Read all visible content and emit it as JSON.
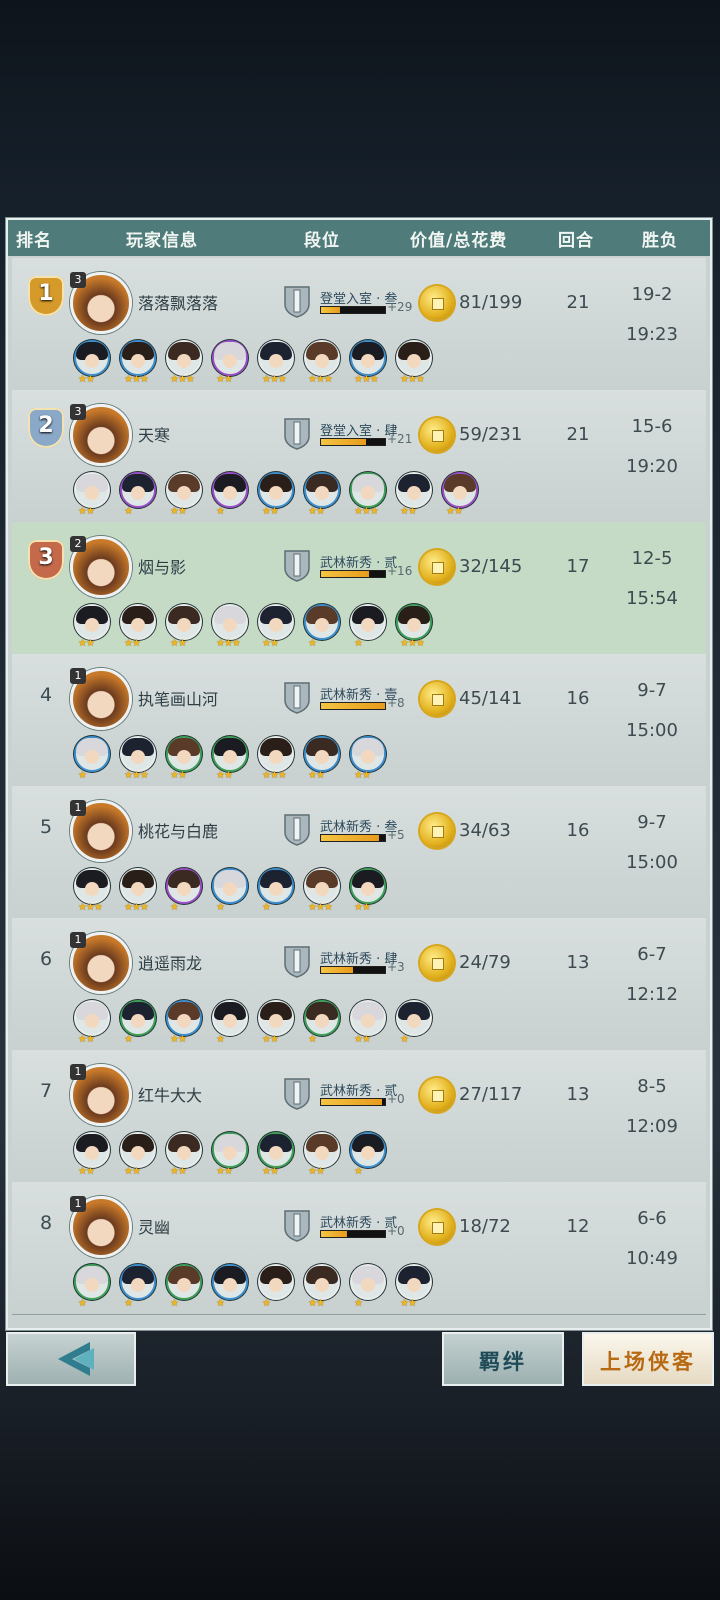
{
  "header": {
    "rank": "排名",
    "player": "玩家信息",
    "segment": "段位",
    "value": "价值/总花费",
    "round": "回合",
    "winloss": "胜负"
  },
  "rows": [
    {
      "rank": "1",
      "medal": "gold",
      "level": "3",
      "name": "落落飘落落",
      "segment": "登堂入室 · 叁",
      "progress": 0.3,
      "points": "+29",
      "value": "81/199",
      "round": "21",
      "wl": "19-2",
      "time": "19:23",
      "highlight": false,
      "heroes": [
        {
          "ring": "blue",
          "stars": "★★"
        },
        {
          "ring": "blue",
          "stars": "★★★"
        },
        {
          "ring": "dark",
          "stars": "★★★"
        },
        {
          "ring": "purple",
          "stars": "★★"
        },
        {
          "ring": "dark",
          "stars": "★★★"
        },
        {
          "ring": "dark",
          "stars": "★★★"
        },
        {
          "ring": "blue",
          "stars": "★★★"
        },
        {
          "ring": "dark",
          "stars": "★★★"
        }
      ]
    },
    {
      "rank": "2",
      "medal": "silver",
      "level": "3",
      "name": "天寒",
      "segment": "登堂入室 · 肆",
      "progress": 0.7,
      "points": "+21",
      "value": "59/231",
      "round": "21",
      "wl": "15-6",
      "time": "19:20",
      "highlight": false,
      "heroes": [
        {
          "ring": "dark",
          "stars": "★★"
        },
        {
          "ring": "purple",
          "stars": "★"
        },
        {
          "ring": "dark",
          "stars": "★★"
        },
        {
          "ring": "purple",
          "stars": "★"
        },
        {
          "ring": "blue",
          "stars": "★★"
        },
        {
          "ring": "blue",
          "stars": "★★"
        },
        {
          "ring": "green",
          "stars": "★★★"
        },
        {
          "ring": "dark",
          "stars": "★★"
        },
        {
          "ring": "purple",
          "stars": "★★"
        }
      ]
    },
    {
      "rank": "3",
      "medal": "bronze",
      "level": "2",
      "name": "烟与影",
      "segment": "武林新秀 · 贰",
      "progress": 0.75,
      "points": "+16",
      "value": "32/145",
      "round": "17",
      "wl": "12-5",
      "time": "15:54",
      "highlight": true,
      "heroes": [
        {
          "ring": "dark",
          "stars": "★★"
        },
        {
          "ring": "dark",
          "stars": "★★"
        },
        {
          "ring": "dark",
          "stars": "★★"
        },
        {
          "ring": "dark",
          "stars": "★★★"
        },
        {
          "ring": "dark",
          "stars": "★★"
        },
        {
          "ring": "blue",
          "stars": "★"
        },
        {
          "ring": "dark",
          "stars": "★"
        },
        {
          "ring": "green",
          "stars": "★★★"
        }
      ]
    },
    {
      "rank": "4",
      "medal": "",
      "level": "1",
      "name": "执笔画山河",
      "segment": "武林新秀 · 壹",
      "progress": 1.0,
      "points": "+8",
      "value": "45/141",
      "round": "16",
      "wl": "9-7",
      "time": "15:00",
      "highlight": false,
      "heroes": [
        {
          "ring": "blue",
          "stars": "★"
        },
        {
          "ring": "dark",
          "stars": "★★★"
        },
        {
          "ring": "green",
          "stars": "★★"
        },
        {
          "ring": "green",
          "stars": "★★"
        },
        {
          "ring": "dark",
          "stars": "★★★"
        },
        {
          "ring": "blue",
          "stars": "★★"
        },
        {
          "ring": "blue",
          "stars": "★★"
        }
      ]
    },
    {
      "rank": "5",
      "medal": "",
      "level": "1",
      "name": "桃花与白鹿",
      "segment": "武林新秀 · 叁",
      "progress": 0.9,
      "points": "+5",
      "value": "34/63",
      "round": "16",
      "wl": "9-7",
      "time": "15:00",
      "highlight": false,
      "heroes": [
        {
          "ring": "dark",
          "stars": "★★★"
        },
        {
          "ring": "dark",
          "stars": "★★★"
        },
        {
          "ring": "purple",
          "stars": "★"
        },
        {
          "ring": "blue",
          "stars": "★"
        },
        {
          "ring": "blue",
          "stars": "★"
        },
        {
          "ring": "dark",
          "stars": "★★★"
        },
        {
          "ring": "green",
          "stars": "★★"
        }
      ]
    },
    {
      "rank": "6",
      "medal": "",
      "level": "1",
      "name": "逍遥雨龙",
      "segment": "武林新秀 · 肆",
      "progress": 0.5,
      "points": "+3",
      "value": "24/79",
      "round": "13",
      "wl": "6-7",
      "time": "12:12",
      "highlight": false,
      "heroes": [
        {
          "ring": "dark",
          "stars": "★★"
        },
        {
          "ring": "green",
          "stars": "★"
        },
        {
          "ring": "blue",
          "stars": "★★"
        },
        {
          "ring": "dark",
          "stars": "★"
        },
        {
          "ring": "dark",
          "stars": "★★"
        },
        {
          "ring": "green",
          "stars": "★"
        },
        {
          "ring": "dark",
          "stars": "★★"
        },
        {
          "ring": "dark",
          "stars": "★"
        }
      ]
    },
    {
      "rank": "7",
      "medal": "",
      "level": "1",
      "name": "红牛大大",
      "segment": "武林新秀 · 贰",
      "progress": 0.95,
      "points": "+0",
      "value": "27/117",
      "round": "13",
      "wl": "8-5",
      "time": "12:09",
      "highlight": false,
      "heroes": [
        {
          "ring": "dark",
          "stars": "★★"
        },
        {
          "ring": "dark",
          "stars": "★★"
        },
        {
          "ring": "dark",
          "stars": "★★"
        },
        {
          "ring": "green",
          "stars": "★★"
        },
        {
          "ring": "green",
          "stars": "★★"
        },
        {
          "ring": "dark",
          "stars": "★★"
        },
        {
          "ring": "blue",
          "stars": "★"
        }
      ]
    },
    {
      "rank": "8",
      "medal": "",
      "level": "1",
      "name": "灵幽",
      "segment": "武林新秀 · 贰",
      "progress": 0.4,
      "points": "+0",
      "value": "18/72",
      "round": "12",
      "wl": "6-6",
      "time": "10:49",
      "highlight": false,
      "heroes": [
        {
          "ring": "green",
          "stars": "★"
        },
        {
          "ring": "blue",
          "stars": "★"
        },
        {
          "ring": "green",
          "stars": "★"
        },
        {
          "ring": "blue",
          "stars": "★"
        },
        {
          "ring": "dark",
          "stars": "★"
        },
        {
          "ring": "dark",
          "stars": "★★"
        },
        {
          "ring": "dark",
          "stars": "★"
        },
        {
          "ring": "dark",
          "stars": "★★"
        }
      ]
    }
  ],
  "buttons": {
    "back_icon": "back-arrow-icon",
    "bond": "羁绊",
    "deploy": "上场侠客"
  },
  "colors": {
    "header_bg": "#4f7c7a",
    "highlight_row": "#c6dbc6",
    "gold": "#d59a2a",
    "silver": "#8aa9c8",
    "bronze": "#c46a4a",
    "ring_blue": "#3d8fd0",
    "ring_purple": "#9a4fc8",
    "ring_green": "#3fa05a",
    "ring_dark": "#e8ecec",
    "deploy_text": "#b86a12",
    "bond_text": "#1f4a58"
  }
}
